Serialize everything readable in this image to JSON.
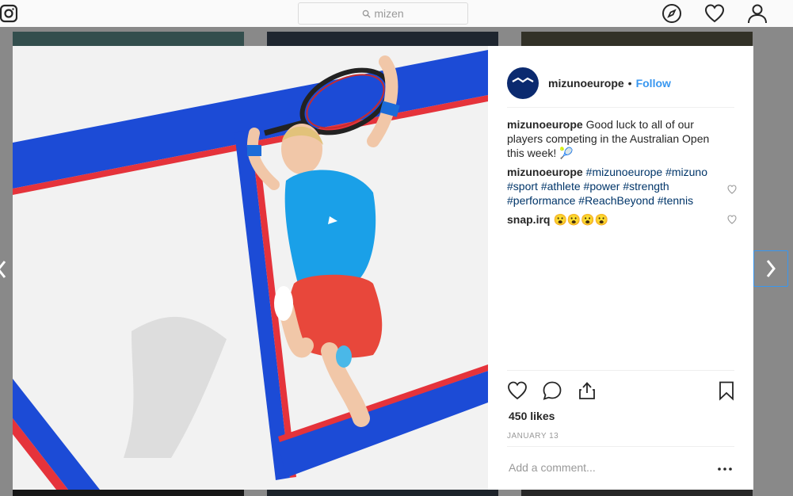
{
  "search": {
    "placeholder": "mizen"
  },
  "post": {
    "username": "mizunoeurope",
    "follow_label": "Follow",
    "separator": "•",
    "avatar_text": "Mizuno",
    "likes": "450 likes",
    "date": "JANUARY 13",
    "add_comment_placeholder": "Add a comment...",
    "comments": [
      {
        "user": "mizunoeurope",
        "text": "Good luck to all of our players competing in the Australian Open this week! 🎾"
      },
      {
        "user": "mizunoeurope",
        "tags": [
          "#mizunoeurope",
          "#mizuno",
          "#sport",
          "#athlete",
          "#power",
          "#strength",
          "#performance",
          "#ReachBeyond",
          "#tennis"
        ]
      },
      {
        "user": "snap.irq",
        "text": "😮😮😮😮"
      }
    ]
  },
  "colors": {
    "accent": "#3897f0",
    "hashtag": "#003569",
    "court_blue": "#1c4bd6",
    "court_red": "#e5333b",
    "dress_blue": "#1aa0e8",
    "skirt_red": "#e8473b"
  },
  "icons": [
    "instagram-icon",
    "search-icon",
    "compass-icon",
    "heart-icon",
    "person-icon",
    "chevron-left-icon",
    "chevron-right-icon",
    "like-icon",
    "comment-icon",
    "share-icon",
    "bookmark-icon",
    "more-icon"
  ]
}
